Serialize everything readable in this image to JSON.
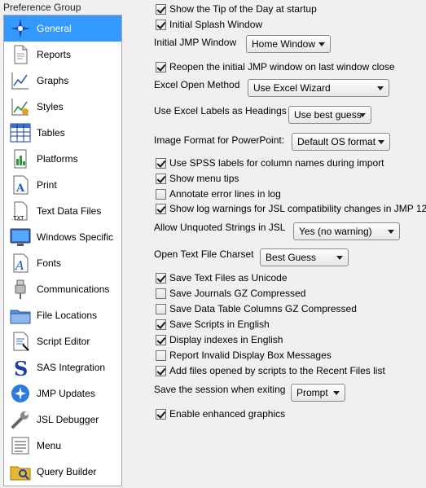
{
  "group_title": "Preference Group",
  "sidebar": {
    "items": [
      {
        "label": "General",
        "icon": "jmp-star-icon"
      },
      {
        "label": "Reports",
        "icon": "report-document-icon"
      },
      {
        "label": "Graphs",
        "icon": "graph-icon"
      },
      {
        "label": "Styles",
        "icon": "styles-icon"
      },
      {
        "label": "Tables",
        "icon": "table-grid-icon"
      },
      {
        "label": "Platforms",
        "icon": "platforms-icon"
      },
      {
        "label": "Print",
        "icon": "print-icon"
      },
      {
        "label": "Text Data Files",
        "icon": "text-file-icon"
      },
      {
        "label": "Windows Specific",
        "icon": "monitor-icon"
      },
      {
        "label": "Fonts",
        "icon": "font-icon"
      },
      {
        "label": "Communications",
        "icon": "usb-plug-icon"
      },
      {
        "label": "File Locations",
        "icon": "folder-icon"
      },
      {
        "label": "Script Editor",
        "icon": "script-editor-icon"
      },
      {
        "label": "SAS Integration",
        "icon": "sas-icon"
      },
      {
        "label": "JMP Updates",
        "icon": "jmp-update-icon"
      },
      {
        "label": "JSL Debugger",
        "icon": "wrench-icon"
      },
      {
        "label": "Menu",
        "icon": "menu-icon"
      },
      {
        "label": "Query Builder",
        "icon": "query-folder-icon"
      }
    ],
    "selected_index": 0,
    "selected_color": "#3399ff"
  },
  "options": {
    "show_tip": {
      "label": "Show the Tip of the Day at startup",
      "checked": true
    },
    "initial_splash": {
      "label": "Initial Splash Window",
      "checked": true
    },
    "initial_jmp_window_label": "Initial JMP Window",
    "initial_jmp_window_value": "Home Window",
    "reopen_initial": {
      "label": "Reopen the initial JMP window on last window close",
      "checked": true
    },
    "excel_open_method_label": "Excel Open Method",
    "excel_open_method_value": "Use Excel Wizard",
    "excel_labels_headings_label": "Use Excel Labels as Headings",
    "excel_labels_headings_value": "Use best guess",
    "image_format_label": "Image Format for PowerPoint:",
    "image_format_value": "Default OS format",
    "spss_labels": {
      "label": "Use SPSS labels for column names during import",
      "checked": true
    },
    "show_menu_tips": {
      "label": "Show menu tips",
      "checked": true
    },
    "annotate_error_lines": {
      "label": "Annotate error lines in log",
      "checked": false
    },
    "show_log_warnings": {
      "label": "Show log warnings for JSL compatibility changes in JMP 12",
      "checked": true
    },
    "allow_unquoted_label": "Allow Unquoted Strings in JSL",
    "allow_unquoted_value": "Yes (no warning)",
    "open_text_charset_label": "Open Text File Charset",
    "open_text_charset_value": "Best Guess",
    "save_text_unicode": {
      "label": "Save Text Files as Unicode",
      "checked": true
    },
    "save_journals_gz": {
      "label": "Save Journals GZ Compressed",
      "checked": false
    },
    "save_dt_columns_gz": {
      "label": "Save Data Table Columns GZ Compressed",
      "checked": false
    },
    "save_scripts_english": {
      "label": "Save Scripts in English",
      "checked": true
    },
    "display_indexes_english": {
      "label": "Display indexes in English",
      "checked": true
    },
    "report_invalid_display": {
      "label": "Report Invalid Display Box Messages",
      "checked": false
    },
    "add_files_recent": {
      "label": "Add files opened by scripts to the Recent Files list",
      "checked": true
    },
    "save_session_label": "Save the session when exiting",
    "save_session_value": "Prompt",
    "enable_enhanced_graphics": {
      "label": "Enable enhanced graphics",
      "checked": true
    }
  }
}
